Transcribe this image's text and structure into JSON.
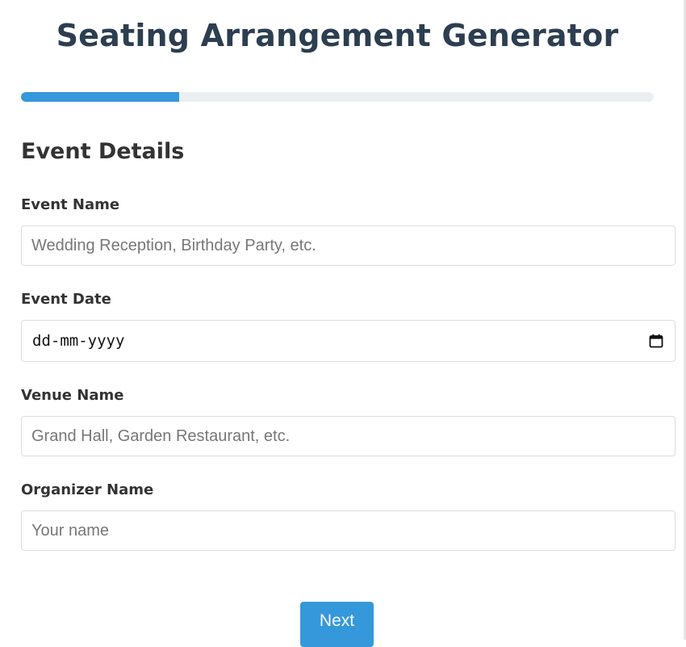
{
  "header": {
    "title": "Seating Arrangement Generator"
  },
  "progress": {
    "fraction": 0.25,
    "color": "#3498db"
  },
  "section": {
    "title": "Event Details"
  },
  "fields": {
    "event_name": {
      "label": "Event Name",
      "placeholder": "Wedding Reception, Birthday Party, etc."
    },
    "event_date": {
      "label": "Event Date",
      "value": "dd-mm-yyyy",
      "icon": "calendar-icon"
    },
    "venue_name": {
      "label": "Venue Name",
      "placeholder": "Grand Hall, Garden Restaurant, etc."
    },
    "organizer_name": {
      "label": "Organizer Name",
      "placeholder": "Your name"
    }
  },
  "actions": {
    "next_label": "Next"
  }
}
